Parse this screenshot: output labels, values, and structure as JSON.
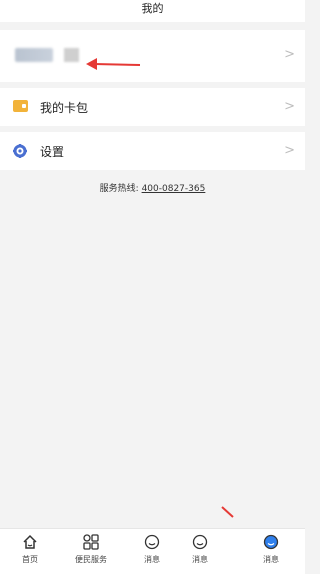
{
  "header": {
    "title": "我的"
  },
  "profile": {
    "chevron": ">"
  },
  "menu": [
    {
      "label": "我的卡包",
      "icon": "card-wallet-icon",
      "chevron": ">"
    },
    {
      "label": "设置",
      "icon": "gear-icon",
      "chevron": ">"
    }
  ],
  "hotline": {
    "label": "服务热线:",
    "number": "400-0827-365"
  },
  "tabbar": {
    "tabs": [
      {
        "label": "首页",
        "icon": "home-icon"
      },
      {
        "label": "便民服务",
        "icon": "grid-icon"
      },
      {
        "label": "消息",
        "icon": "smile-icon"
      },
      {
        "label": "消息",
        "icon": "smile-icon"
      },
      {
        "label": "消息",
        "icon": "smile-icon",
        "active": true
      }
    ]
  },
  "colors": {
    "annotation_red": "#e53935",
    "card_icon": "#f2b33a",
    "gear_icon": "#4a6fd1",
    "active_tab": "#2f80ed"
  }
}
